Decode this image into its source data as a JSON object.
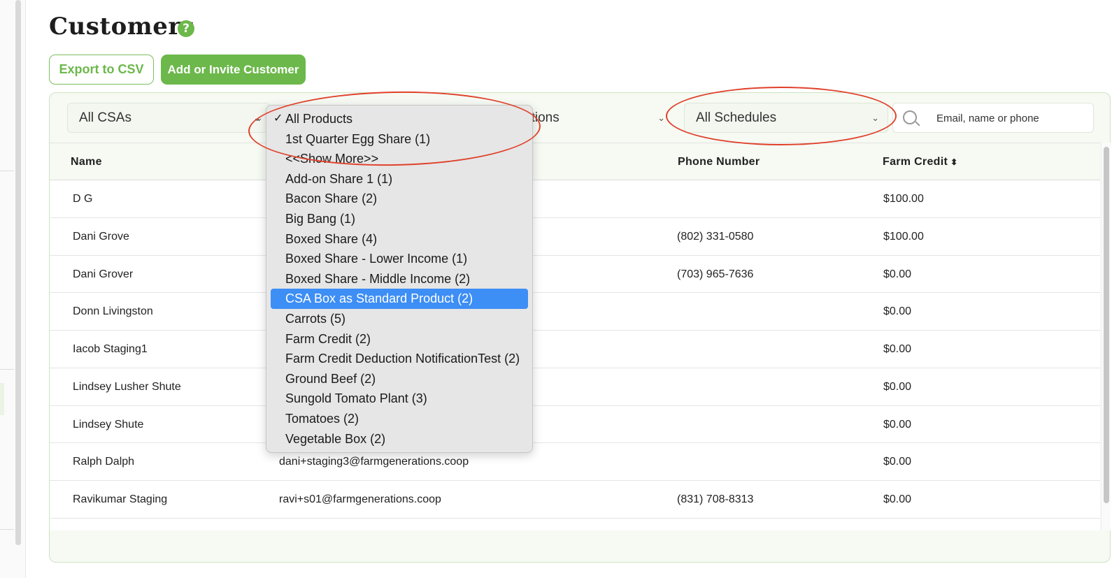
{
  "page": {
    "title": "Customers",
    "help_icon": "question-circle-icon"
  },
  "actions": {
    "export_label": "Export to CSV",
    "add_label": "Add or Invite Customer"
  },
  "filters": {
    "csa": "All CSAs",
    "locations_partial": "ations",
    "schedules": "All Schedules",
    "search_placeholder": "Email, name or phone"
  },
  "table": {
    "headers": {
      "name": "Name",
      "phone": "Phone Number",
      "credit": "Farm Credit",
      "credit_sort_icon": "⬍"
    },
    "rows": [
      {
        "name": "D G",
        "email": "",
        "phone": "",
        "credit": "$100.00"
      },
      {
        "name": "Dani Grove",
        "email": "",
        "phone": "(802) 331-0580",
        "credit": "$100.00"
      },
      {
        "name": "Dani Grover",
        "email": "",
        "phone": "(703) 965-7636",
        "credit": "$0.00"
      },
      {
        "name": "Donn Livingston",
        "email": "",
        "phone": "",
        "credit": "$0.00"
      },
      {
        "name": "Iacob Staging1",
        "email": "",
        "phone": "",
        "credit": "$0.00"
      },
      {
        "name": "Lindsey Lusher Shute",
        "email": "",
        "phone": "",
        "credit": "$0.00"
      },
      {
        "name": "Lindsey Shute",
        "email": "",
        "phone": "",
        "credit": "$0.00"
      },
      {
        "name": "Ralph Dalph",
        "email": "dani+staging3@farmgenerations.coop",
        "phone": "",
        "credit": "$0.00"
      },
      {
        "name": "Ravikumar Staging",
        "email": "ravi+s01@farmgenerations.coop",
        "phone": "(831) 708-8313",
        "credit": "$0.00"
      }
    ]
  },
  "products_dropdown": {
    "check_mark": "✓",
    "items": [
      "All Products",
      "1st Quarter Egg Share (1)",
      "<<Show More>>",
      "Add-on Share 1 (1)",
      "Bacon Share (2)",
      "Big Bang (1)",
      "Boxed Share (4)",
      "Boxed Share - Lower Income (1)",
      "Boxed Share - Middle Income (2)",
      "CSA Box as Standard Product (2)",
      "Carrots (5)",
      "Farm Credit (2)",
      "Farm Credit Deduction NotificationTest (2)",
      "Ground Beef (2)",
      "Sungold Tomato Plant (3)",
      "Tomatoes (2)",
      "Vegetable Box (2)"
    ]
  },
  "colors": {
    "brand_green": "#6cb84b",
    "highlight_blue": "#3d8ef5",
    "annotation_red": "#e0412b"
  }
}
